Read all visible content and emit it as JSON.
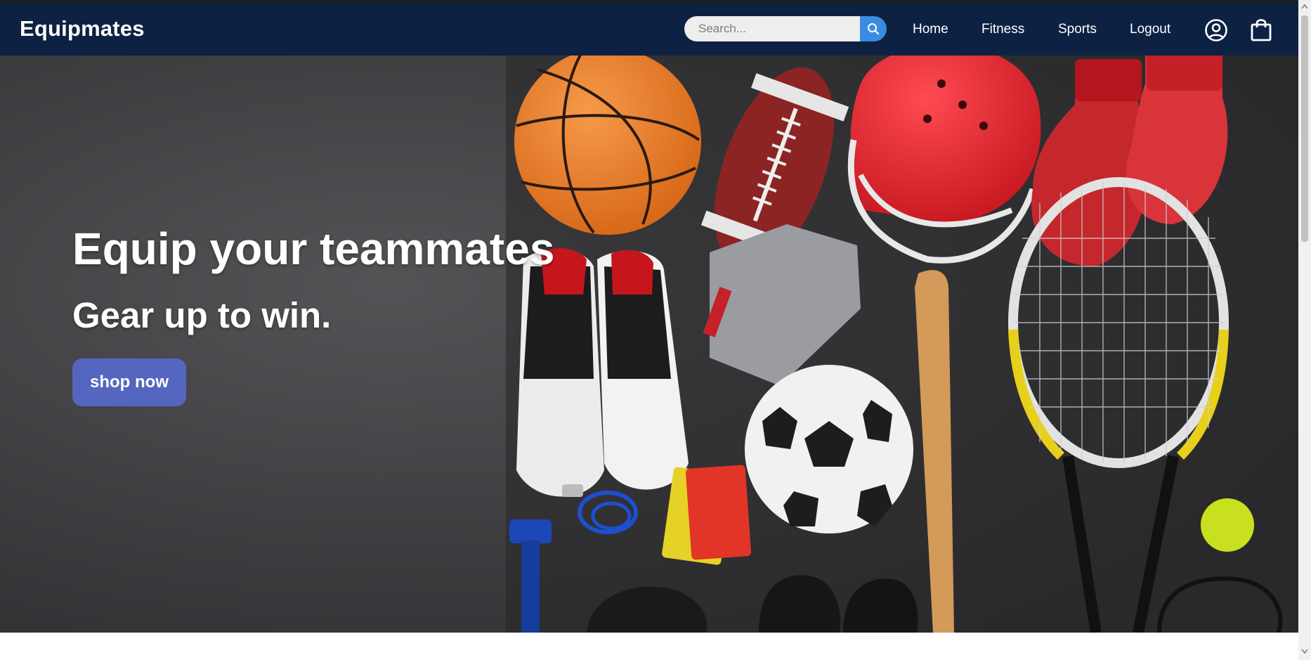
{
  "navbar": {
    "brand": "Equipmates",
    "search": {
      "placeholder": "Search...",
      "value": ""
    },
    "links": [
      "Home",
      "Fitness",
      "Sports",
      "Logout"
    ],
    "icons": [
      "search-icon",
      "user-circle-icon",
      "shopping-bag-icon"
    ]
  },
  "hero": {
    "title": "Equip your teammates",
    "subtitle": "Gear up to win.",
    "cta_label": "shop now",
    "image_contents": [
      "basketball",
      "american-football",
      "football-helmet",
      "boxing-gloves",
      "sneakers",
      "gloves",
      "baseball-bat",
      "tennis-racket",
      "tennis-ball",
      "soccer-ball",
      "referee-cards",
      "whistle",
      "dumbbell"
    ]
  },
  "colors": {
    "navbar_bg": "#0d2142",
    "search_button": "#3a8ce0",
    "cta_button": "#5566c0",
    "hero_bg": "#3d3d40"
  }
}
